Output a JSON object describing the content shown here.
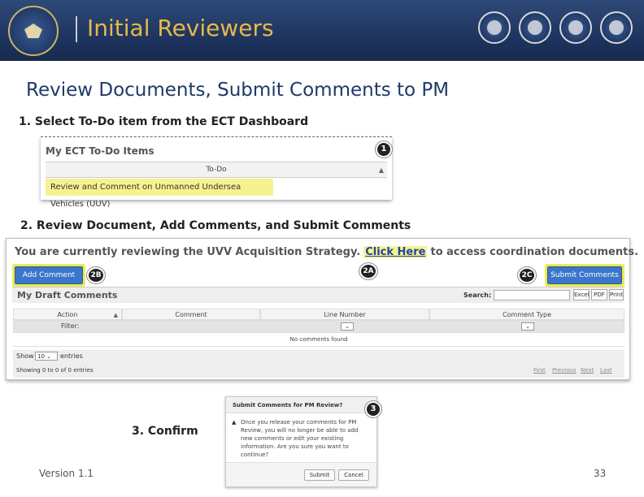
{
  "header": {
    "title": "Initial Reviewers",
    "seals": [
      "dod-seal-icon",
      "army-seal-icon",
      "marine-seal-icon",
      "navy-seal-icon",
      "air-force-seal-icon"
    ]
  },
  "page_title": "Review Documents, Submit Comments to PM",
  "steps": {
    "s1": "1.  Select To-Do item from the ECT Dashboard",
    "s2": "2.  Review Document, Add Comments, and Submit Comments",
    "s3": "3.  Confirm"
  },
  "badges": {
    "b1": "1",
    "b2a": "2A",
    "b2b": "2B",
    "b2c": "2C",
    "b3": "3"
  },
  "todo_panel": {
    "heading": "My ECT To-Do Items",
    "column": "To-Do",
    "sort_glyph": "▲",
    "item": "Review and Comment on Unmanned Undersea Vehicles (UUV)"
  },
  "review_panel": {
    "banner_prefix": "You are currently reviewing the UVV Acquisition Strategy.",
    "banner_link": "Click Here",
    "banner_suffix": "to access coordination documents.",
    "add_comment": "Add Comment",
    "submit_comments": "Submit Comments",
    "drafts_title": "My Draft Comments",
    "search_label": "Search:",
    "search_value": "",
    "export_buttons": [
      "Excel",
      "PDF",
      "Print"
    ],
    "columns": [
      "Action",
      "Comment",
      "Line Number",
      "Comment Type"
    ],
    "filter_label": "Filter:",
    "select_glyph": "⌄",
    "empty_text": "No comments found",
    "show_label": "Show",
    "show_value": "10 ⌄",
    "entries_label": "entries",
    "showing_text": "Showing 0 to 0 of 0 entries",
    "pager": [
      "First",
      "Previous",
      "Next",
      "Last"
    ]
  },
  "dialog": {
    "title": "Submit Comments for PM Review?",
    "icon": "▲",
    "message": "Once you release your comments for PM Review, you will no longer be able to add new comments or edit your existing information. Are you sure you want to continue?",
    "submit": "Submit",
    "cancel": "Cancel"
  },
  "footer": {
    "version": "Version 1.1",
    "page": "33"
  }
}
